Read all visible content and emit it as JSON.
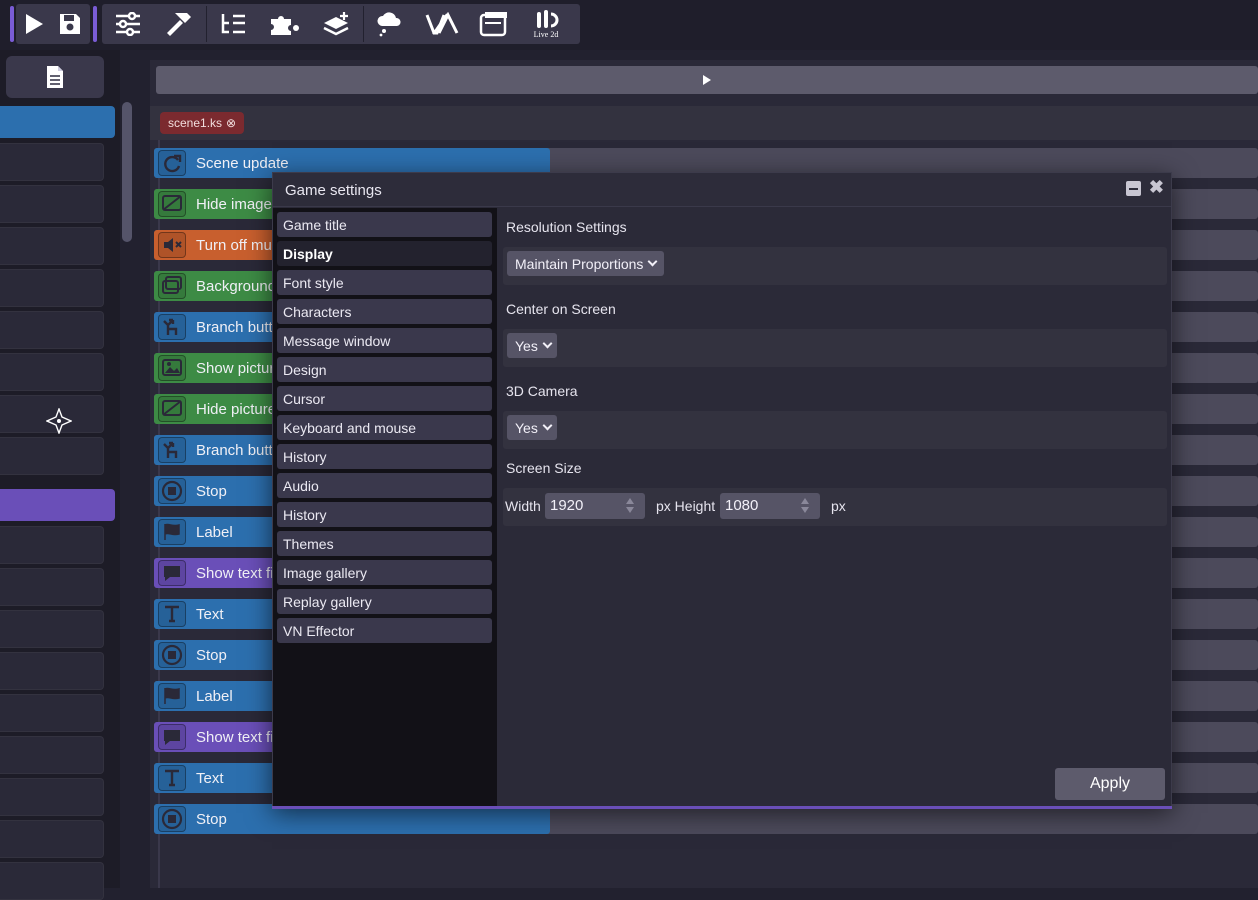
{
  "colors": {
    "accent_purple": "#6a4fb8",
    "blue": "#2c6fae",
    "green": "#3d8b45",
    "orange": "#c85f2e",
    "violet": "#6a4fb8",
    "tab_red": "#7b2a2f"
  },
  "toolbar": {
    "buttons": [
      "play-icon",
      "save-icon",
      "sliders-icon",
      "hammer-icon",
      "list-tree-icon",
      "puzzle-icon",
      "layers-plus-icon",
      "cloud-icon",
      "va-icon",
      "window-icon",
      "live2d-icon"
    ],
    "live2d_label": "Live 2d",
    "va_label": "VA"
  },
  "editor": {
    "tab_name": "scene1.ks",
    "tab_close": "⊗"
  },
  "commands": [
    {
      "label": "Scene update",
      "color": "blue",
      "icon": "refresh-icon"
    },
    {
      "label": "Hide image",
      "color": "green",
      "icon": "hide-image-icon"
    },
    {
      "label": "Turn off mu",
      "color": "orange",
      "icon": "mute-icon"
    },
    {
      "label": "Background",
      "color": "green",
      "icon": "background-icon"
    },
    {
      "label": "Branch butt",
      "color": "blue",
      "icon": "branch-icon"
    },
    {
      "label": "Show pictur",
      "color": "green",
      "icon": "picture-icon"
    },
    {
      "label": "Hide picture",
      "color": "green",
      "icon": "hide-picture-icon"
    },
    {
      "label": "Branch butt",
      "color": "blue",
      "icon": "branch-icon"
    },
    {
      "label": "Stop",
      "color": "blue",
      "icon": "stop-icon"
    },
    {
      "label": "Label",
      "color": "blue",
      "icon": "flag-icon"
    },
    {
      "label": "Show text fi",
      "color": "violet",
      "icon": "speech-icon"
    },
    {
      "label": "Text",
      "color": "blue",
      "icon": "text-icon"
    },
    {
      "label": "Stop",
      "color": "blue",
      "icon": "stop-icon"
    },
    {
      "label": "Label",
      "color": "blue",
      "icon": "flag-icon"
    },
    {
      "label": "Show text fi",
      "color": "violet",
      "icon": "speech-icon"
    },
    {
      "label": "Text",
      "color": "blue",
      "icon": "text-icon"
    },
    {
      "label": "Stop",
      "color": "blue",
      "icon": "stop-icon"
    }
  ],
  "modal": {
    "title": "Game settings",
    "nav": [
      "Game title",
      "Display",
      "Font style",
      "Characters",
      "Message window",
      "Design",
      "Cursor",
      "Keyboard and mouse",
      "History",
      "Audio",
      "History",
      "Themes",
      "Image gallery",
      "Replay gallery",
      "VN Effector"
    ],
    "active_nav": "Display",
    "resolution": {
      "label": "Resolution Settings",
      "value": "Maintain Proportions"
    },
    "center": {
      "label": "Center on Screen",
      "value": "Yes"
    },
    "camera": {
      "label": "3D Camera",
      "value": "Yes"
    },
    "screen_size": {
      "label": "Screen Size",
      "width_label": "Width",
      "width_value": "1920",
      "px1": "px Height",
      "height_value": "1080",
      "px2": "px"
    },
    "apply_label": "Apply"
  }
}
